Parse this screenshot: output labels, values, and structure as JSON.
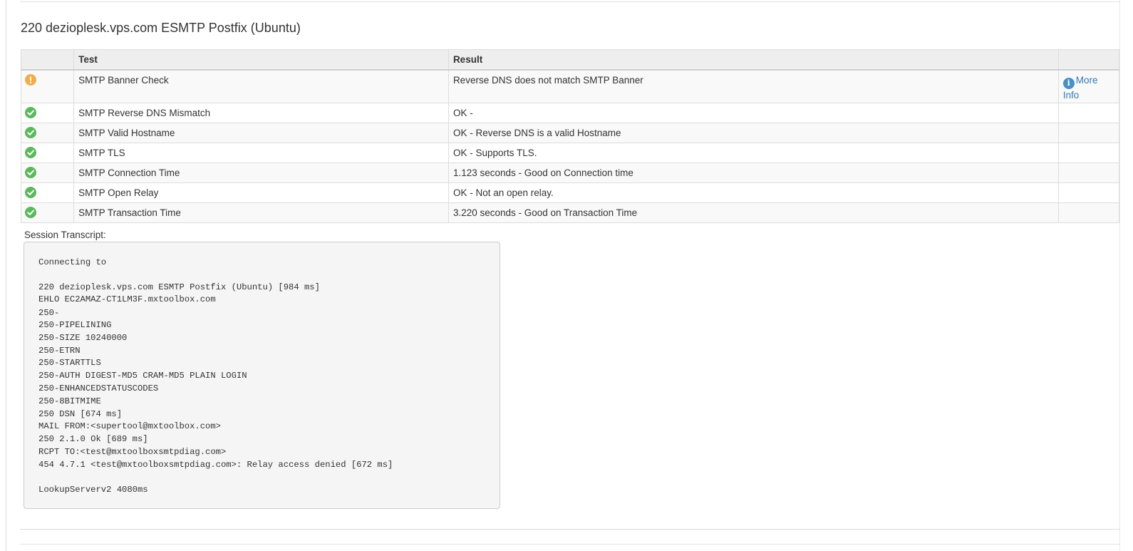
{
  "heading": "220 dezioplesk.vps.com ESMTP Postfix (Ubuntu)",
  "table": {
    "headers": [
      "",
      "Test",
      "Result",
      ""
    ],
    "rows": [
      {
        "status": "warning",
        "test": "SMTP Banner Check",
        "result": "Reverse DNS does not match SMTP Banner",
        "action": "More Info"
      },
      {
        "status": "ok",
        "test": "SMTP Reverse DNS Mismatch",
        "result": "OK - ",
        "action": ""
      },
      {
        "status": "ok",
        "test": "SMTP Valid Hostname",
        "result": "OK - Reverse DNS is a valid Hostname",
        "action": ""
      },
      {
        "status": "ok",
        "test": "SMTP TLS",
        "result": "OK - Supports TLS.",
        "action": ""
      },
      {
        "status": "ok",
        "test": "SMTP Connection Time",
        "result": "1.123 seconds - Good on Connection time",
        "action": ""
      },
      {
        "status": "ok",
        "test": "SMTP Open Relay",
        "result": "OK - Not an open relay.",
        "action": ""
      },
      {
        "status": "ok",
        "test": "SMTP Transaction Time",
        "result": "3.220 seconds - Good on Transaction Time",
        "action": ""
      }
    ]
  },
  "transcript": {
    "label": "Session Transcript:",
    "lines": [
      "Connecting to ",
      "",
      "220 dezioplesk.vps.com ESMTP Postfix (Ubuntu) [984 ms]",
      "EHLO EC2AMAZ-CT1LM3F.mxtoolbox.com",
      "250-",
      "250-PIPELINING",
      "250-SIZE 10240000",
      "250-ETRN",
      "250-STARTTLS",
      "250-AUTH DIGEST-MD5 CRAM-MD5 PLAIN LOGIN",
      "250-ENHANCEDSTATUSCODES",
      "250-8BITMIME",
      "250 DSN [674 ms]",
      "MAIL FROM:<supertool@mxtoolbox.com>",
      "250 2.1.0 Ok [689 ms]",
      "RCPT TO:<test@mxtoolboxsmtpdiag.com>",
      "454 4.7.1 <test@mxtoolboxsmtpdiag.com>: Relay access denied [672 ms]",
      "",
      "LookupServerv2 4080ms"
    ]
  },
  "colors": {
    "ok": "#5cb85c",
    "warning": "#f0ad4e",
    "link": "#337ab7"
  },
  "icons": {
    "ok": "check-circle-icon",
    "warning": "exclamation-circle-icon",
    "info": "info-circle-icon"
  }
}
